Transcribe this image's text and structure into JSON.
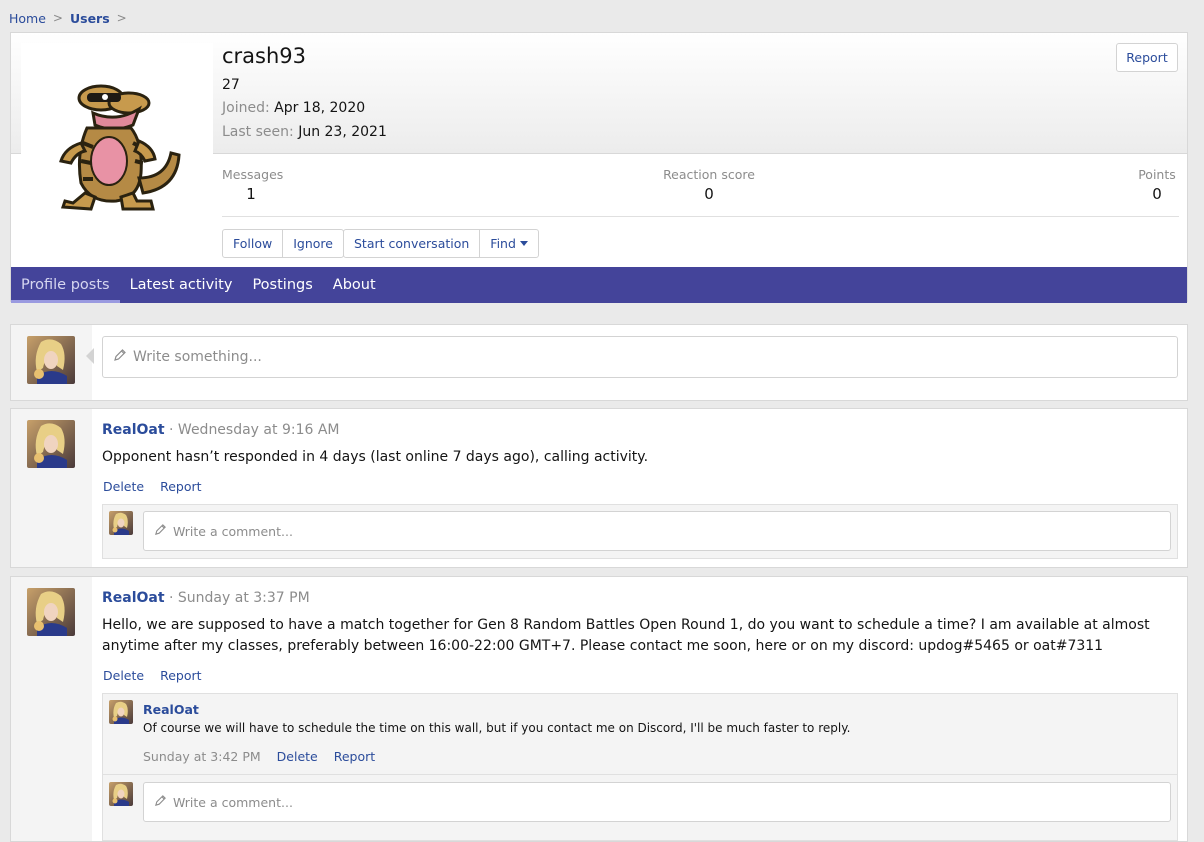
{
  "breadcrumb": {
    "home": "Home",
    "users": "Users",
    "sep": ">"
  },
  "profile": {
    "username": "crash93",
    "age": "27",
    "joined_label": "Joined:",
    "joined_value": "Apr 18, 2020",
    "last_seen_label": "Last seen:",
    "last_seen_value": "Jun 23, 2021",
    "report_label": "Report",
    "stats": {
      "messages_label": "Messages",
      "messages_value": "1",
      "reaction_label": "Reaction score",
      "reaction_value": "0",
      "points_label": "Points",
      "points_value": "0"
    },
    "buttons": {
      "follow": "Follow",
      "ignore": "Ignore",
      "start_conversation": "Start conversation",
      "find": "Find"
    }
  },
  "tabs": [
    {
      "label": "Profile posts"
    },
    {
      "label": "Latest activity"
    },
    {
      "label": "Postings"
    },
    {
      "label": "About"
    }
  ],
  "composer": {
    "placeholder": "Write something..."
  },
  "posts": [
    {
      "author": "RealOat",
      "time": "· Wednesday at 9:16 AM",
      "body": "Opponent hasn’t responded in 4 days (last online 7 days ago), calling activity.",
      "delete": "Delete",
      "report": "Report",
      "comment_placeholder": "Write a comment..."
    },
    {
      "author": "RealOat",
      "time": "· Sunday at 3:37 PM",
      "body": "Hello, we are supposed to have a match together for Gen 8 Random Battles Open Round 1, do you want to schedule a time? I am available at almost anytime after my classes, preferably between 16:00-22:00 GMT+7. Please contact me soon, here or on my discord: updog#5465 or oat#7311",
      "delete": "Delete",
      "report": "Report",
      "reply": {
        "author": "RealOat",
        "body": "Of course we will have to schedule the time on this wall, but if you contact me on Discord, I'll be much faster to reply.",
        "time": "Sunday at 3:42 PM",
        "delete": "Delete",
        "report": "Report"
      },
      "comment_placeholder": "Write a comment..."
    }
  ],
  "colors": {
    "accent": "#2b4c9b",
    "tabbar": "#44449a",
    "background": "#eaeaea"
  }
}
